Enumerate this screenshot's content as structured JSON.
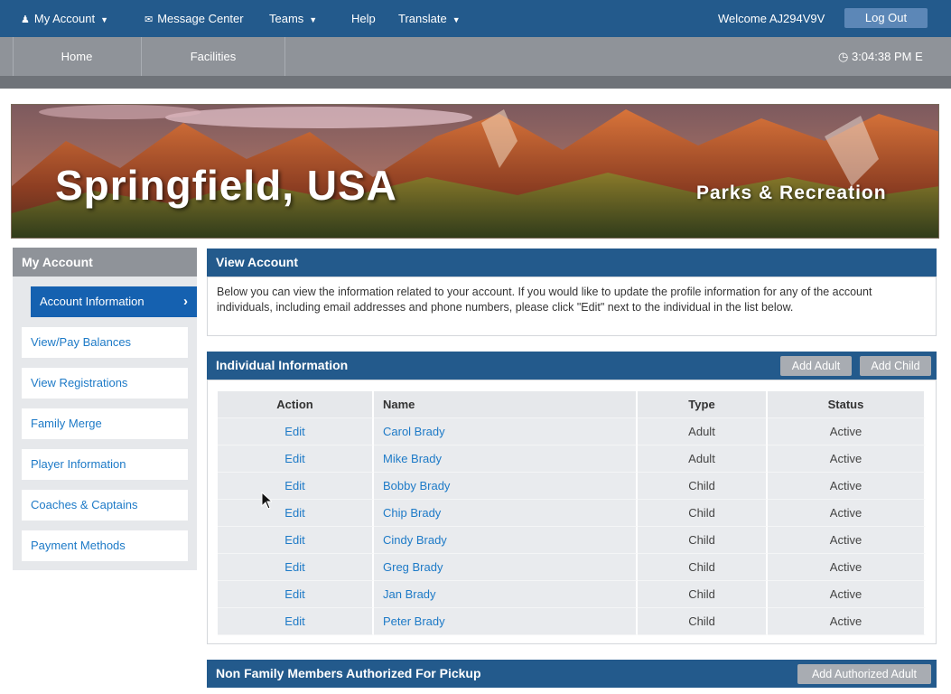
{
  "topnav": {
    "my_account": "My Account",
    "message_center": "Message Center",
    "teams": "Teams",
    "help": "Help",
    "translate": "Translate",
    "welcome": "Welcome AJ294V9V",
    "logout": "Log Out"
  },
  "subnav": {
    "tabs": [
      "Home",
      "Facilities"
    ],
    "time": "3:04:38 PM E"
  },
  "banner": {
    "city": "Springfield, USA",
    "department": "Parks & Recreation"
  },
  "sidebar": {
    "title": "My Account",
    "items": [
      {
        "label": "Account Information"
      },
      {
        "label": "View/Pay Balances"
      },
      {
        "label": "View Registrations"
      },
      {
        "label": "Family Merge"
      },
      {
        "label": "Player Information"
      },
      {
        "label": "Coaches & Captains"
      },
      {
        "label": "Payment Methods"
      }
    ]
  },
  "view_account": {
    "title": "View Account",
    "description": "Below you can view the information related to your account. If you would like to update the profile information for any of the account individuals, including email addresses and phone numbers, please click \"Edit\" next to the individual in the list below."
  },
  "individual_info": {
    "title": "Individual Information",
    "add_adult": "Add Adult",
    "add_child": "Add Child",
    "columns": {
      "action": "Action",
      "name": "Name",
      "type": "Type",
      "status": "Status"
    },
    "rows": [
      {
        "action": "Edit",
        "name": "Carol Brady",
        "type": "Adult",
        "status": "Active"
      },
      {
        "action": "Edit",
        "name": "Mike Brady",
        "type": "Adult",
        "status": "Active"
      },
      {
        "action": "Edit",
        "name": "Bobby Brady",
        "type": "Child",
        "status": "Active"
      },
      {
        "action": "Edit",
        "name": "Chip Brady",
        "type": "Child",
        "status": "Active"
      },
      {
        "action": "Edit",
        "name": "Cindy Brady",
        "type": "Child",
        "status": "Active"
      },
      {
        "action": "Edit",
        "name": "Greg Brady",
        "type": "Child",
        "status": "Active"
      },
      {
        "action": "Edit",
        "name": "Jan Brady",
        "type": "Child",
        "status": "Active"
      },
      {
        "action": "Edit",
        "name": "Peter Brady",
        "type": "Child",
        "status": "Active"
      }
    ]
  },
  "pickup": {
    "title": "Non Family Members Authorized For Pickup",
    "add_authorized_adult": "Add Authorized Adult"
  },
  "colors": {
    "nav_blue": "#235a8c",
    "link_blue": "#1d7ac7",
    "active_blue": "#1561b0",
    "gray_bar": "#8f9399"
  }
}
